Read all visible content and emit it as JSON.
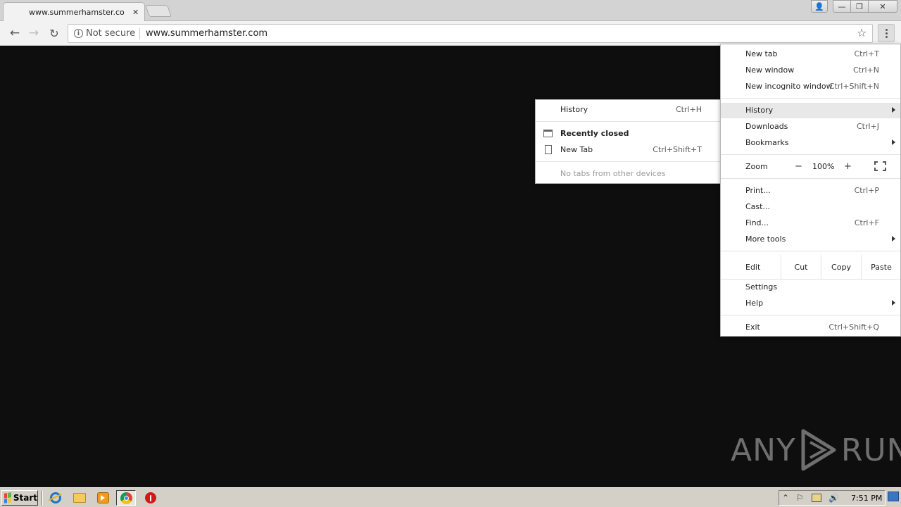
{
  "browser": {
    "tab": {
      "title": "www.summerhamster.com (",
      "close_glyph": "✕"
    },
    "window_controls": {
      "user": "👤",
      "minimize": "—",
      "maximize": "❐",
      "close": "✕"
    },
    "nav": {
      "back": "←",
      "forward": "→",
      "reload": "↻"
    },
    "omnibox": {
      "info_glyph": "i",
      "security_label": "Not secure",
      "url": "www.summerhamster.com",
      "star": "☆"
    }
  },
  "main_menu": {
    "items": [
      {
        "label": "New tab",
        "shortcut": "Ctrl+T"
      },
      {
        "label": "New window",
        "shortcut": "Ctrl+N"
      },
      {
        "label": "New incognito window",
        "shortcut": "Ctrl+Shift+N"
      },
      {
        "label": "History",
        "shortcut": ""
      },
      {
        "label": "Downloads",
        "shortcut": "Ctrl+J"
      },
      {
        "label": "Bookmarks",
        "shortcut": ""
      },
      {
        "label": "Zoom",
        "shortcut": ""
      },
      {
        "label": "Print...",
        "shortcut": "Ctrl+P"
      },
      {
        "label": "Cast...",
        "shortcut": ""
      },
      {
        "label": "Find...",
        "shortcut": "Ctrl+F"
      },
      {
        "label": "More tools",
        "shortcut": ""
      },
      {
        "label": "Edit",
        "shortcut": ""
      },
      {
        "label": "Settings",
        "shortcut": ""
      },
      {
        "label": "Help",
        "shortcut": ""
      },
      {
        "label": "Exit",
        "shortcut": "Ctrl+Shift+Q"
      }
    ],
    "zoom": {
      "minus": "−",
      "value": "100%",
      "plus": "+"
    },
    "edit": {
      "cut": "Cut",
      "copy": "Copy",
      "paste": "Paste"
    }
  },
  "history_submenu": {
    "history": {
      "label": "History",
      "shortcut": "Ctrl+H"
    },
    "recently_closed": "Recently closed",
    "new_tab": {
      "label": "New Tab",
      "shortcut": "Ctrl+Shift+T"
    },
    "no_tabs": "No tabs from other devices"
  },
  "watermark": {
    "left": "ANY",
    "right": "RUN"
  },
  "taskbar": {
    "start": "Start",
    "tray": {
      "expand": "⌃",
      "flag": "⚐",
      "volume": "🔊"
    },
    "clock": "7:51 PM"
  },
  "colors": {
    "page_background": "#0e0e0e",
    "menu_highlight": "#e8e8e8",
    "taskbar": "#d4d0c8"
  }
}
